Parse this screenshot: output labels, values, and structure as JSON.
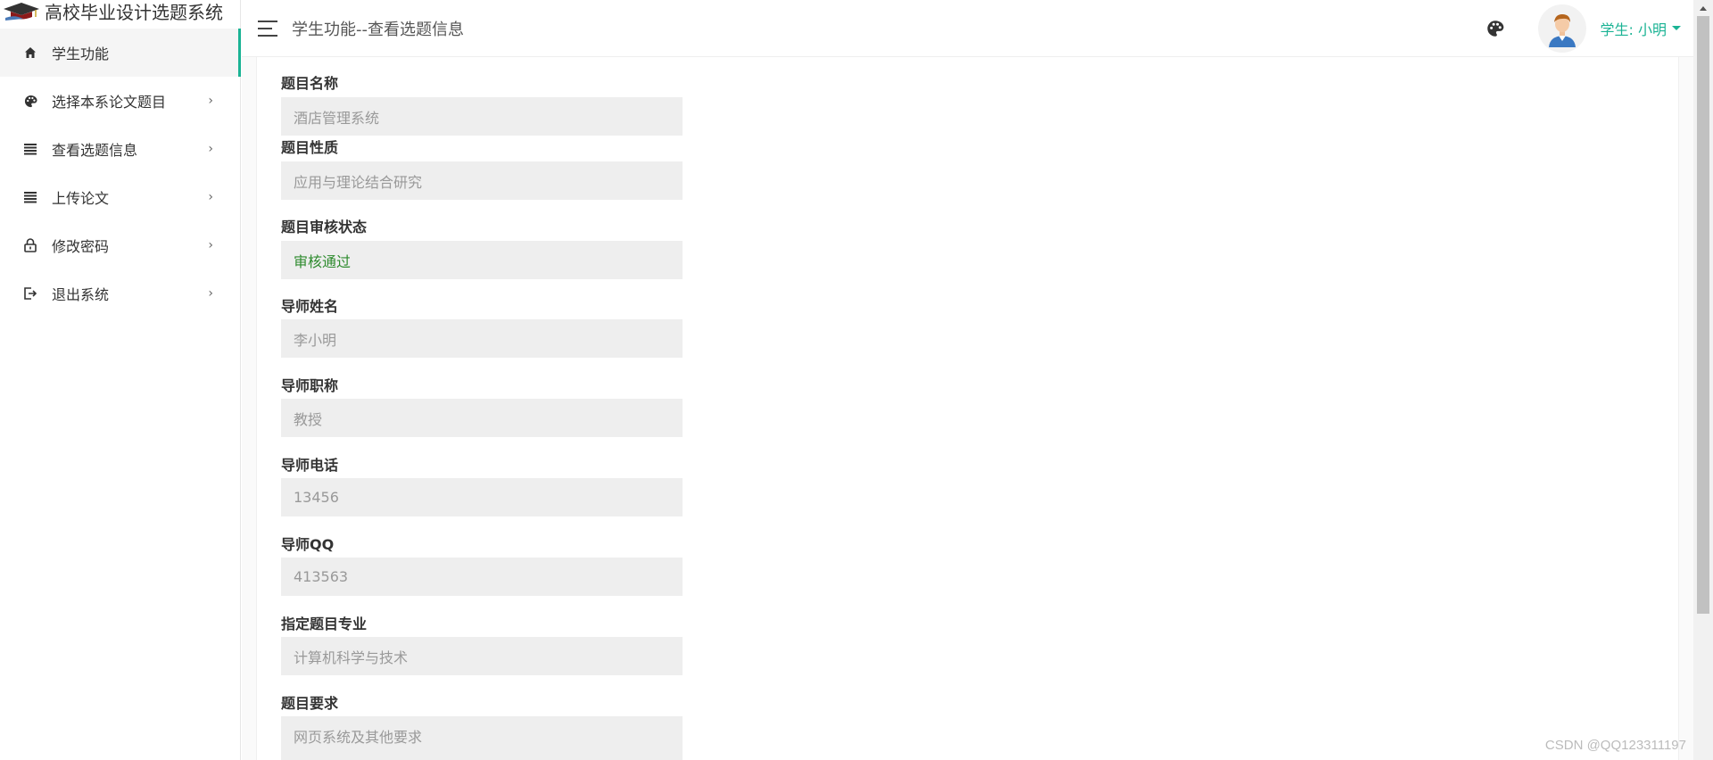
{
  "app": {
    "title": "高校毕业设计选题系统"
  },
  "sidebar": {
    "items": [
      {
        "label": "学生功能",
        "icon": "home-icon",
        "active": true
      },
      {
        "label": "选择本系论文题目",
        "icon": "palette-icon"
      },
      {
        "label": "查看选题信息",
        "icon": "list-icon"
      },
      {
        "label": "上传论文",
        "icon": "list-icon"
      },
      {
        "label": "修改密码",
        "icon": "lock-icon"
      },
      {
        "label": "退出系统",
        "icon": "logout-icon"
      }
    ],
    "chevron": "›"
  },
  "header": {
    "title": "学生功能--查看选题信息",
    "user_label": "学生: 小明"
  },
  "form": {
    "fields": [
      {
        "label": "题目名称",
        "value": "酒店管理系统"
      },
      {
        "label": "题目性质",
        "value": "应用与理论结合研究"
      },
      {
        "label": "题目审核状态",
        "value": "审核通过"
      },
      {
        "label": "导师姓名",
        "value": "李小明"
      },
      {
        "label": "导师职称",
        "value": "教授"
      },
      {
        "label": "导师电话",
        "value": "13456"
      },
      {
        "label": "导师QQ",
        "value": "413563"
      },
      {
        "label": "指定题目专业",
        "value": "计算机科学与技术"
      },
      {
        "label": "题目要求",
        "value": "网页系统及其他要求"
      }
    ]
  },
  "watermark": "CSDN @QQ123311197",
  "colors": {
    "accent": "#1ab394",
    "status_ok": "#2e8b2e",
    "field_bg": "#eeeeee"
  }
}
